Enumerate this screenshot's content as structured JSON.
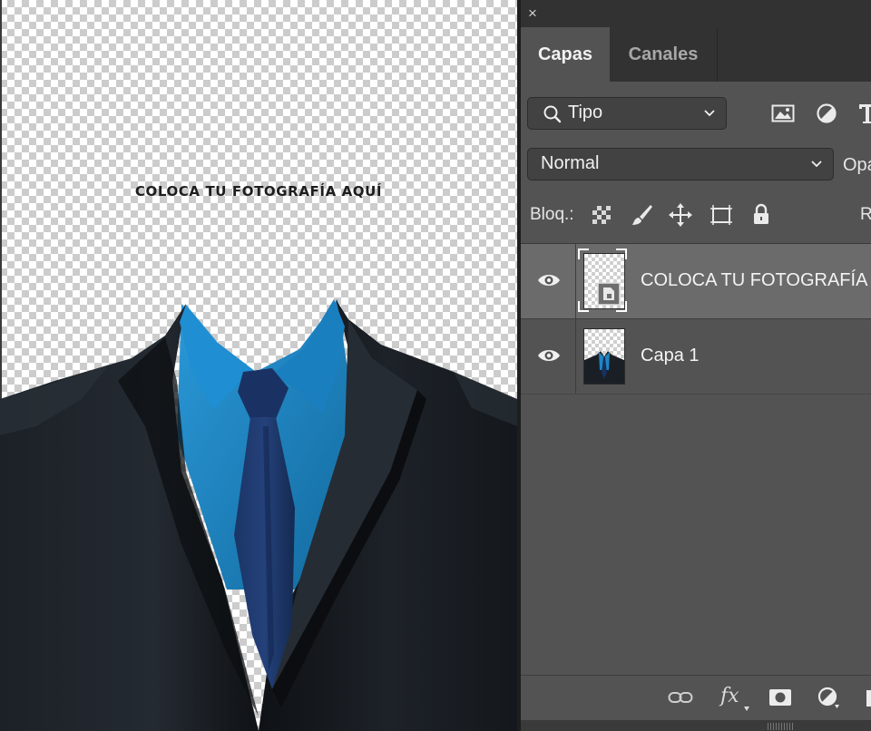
{
  "canvas": {
    "placeholder_text": "COLOCA TU FOTOGRAFÍA AQUÍ"
  },
  "panel": {
    "close_glyph": "×",
    "tabs": [
      {
        "label": "Capas",
        "active": true
      },
      {
        "label": "Canales",
        "active": false
      }
    ],
    "filter": {
      "label": "Tipo",
      "icon": "search-icon"
    },
    "filter_icons": [
      "image-filter-icon",
      "adjustment-filter-icon",
      "type-filter-icon"
    ],
    "blend_mode": "Normal",
    "opacity_label": "Opa",
    "lock_label": "Bloq.:",
    "lock_icons": [
      "lock-transparent-pixels-icon",
      "lock-image-pixels-icon",
      "lock-position-icon",
      "lock-artboard-icon",
      "lock-all-icon"
    ],
    "fill_label": "R",
    "layers": [
      {
        "name": "COLOCA TU FOTOGRAFÍA",
        "visible": true,
        "selected": true,
        "type": "smart-object"
      },
      {
        "name": "Capa 1",
        "visible": true,
        "selected": false,
        "type": "pixel"
      }
    ],
    "bottom_icons": [
      "link-layers-icon",
      "fx-icon",
      "add-mask-icon",
      "new-adjustment-icon",
      "new-group-icon"
    ],
    "fx_label": "fx"
  },
  "colors": {
    "panel_bg": "#535353",
    "selected_layer": "#6b6b6b",
    "shirt": "#1f86c4",
    "jacket": "#14181d",
    "tie": "#17305e"
  }
}
